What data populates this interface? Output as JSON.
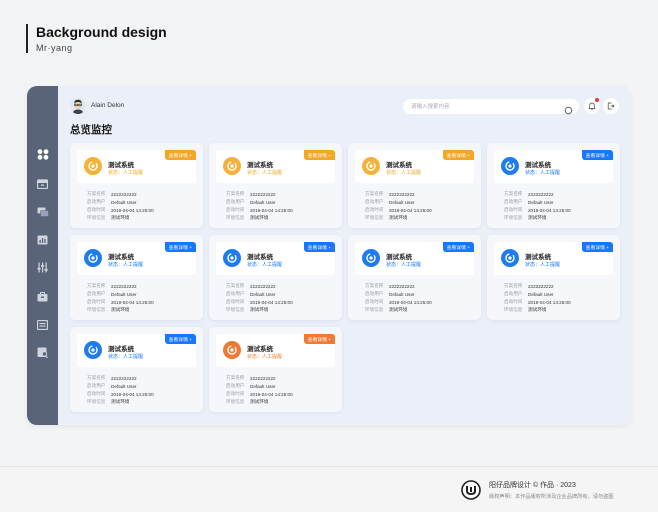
{
  "page": {
    "title": "Background design",
    "subtitle": "Mr·yang"
  },
  "sidebar": {
    "icons": [
      "dashboard-icon",
      "box-icon",
      "chat-icon",
      "chart-icon",
      "sliders-icon",
      "archive-icon",
      "list-icon",
      "search-doc-icon"
    ]
  },
  "topbar": {
    "user_name": "Alain Delon",
    "search_placeholder": "请输入搜索内容"
  },
  "section_title": "总览监控",
  "row_labels": [
    "方案名称",
    "启动用户",
    "启动时间",
    "环境信息"
  ],
  "colors": {
    "orange": "#f5a623",
    "blue": "#1677ff",
    "deep_orange": "#f07a35"
  },
  "cards": [
    {
      "name": "测试系统",
      "status": "状态：人工提醒",
      "button": "查看详情 +",
      "tone": "orange",
      "values": [
        "2222222222",
        "Default User",
        "2019-04-04  14:25:00",
        "测试环境"
      ]
    },
    {
      "name": "测试系统",
      "status": "状态：人工提醒",
      "button": "查看详情 +",
      "tone": "orange",
      "values": [
        "2222222222",
        "Default User",
        "2019-04-04  14:25:00",
        "测试环境"
      ]
    },
    {
      "name": "测试系统",
      "status": "状态：人工提醒",
      "button": "查看详情 +",
      "tone": "orange",
      "values": [
        "2222222222",
        "Default User",
        "2019-04-04  14:25:00",
        "测试环境"
      ]
    },
    {
      "name": "测试系统",
      "status": "状态：人工提醒",
      "button": "查看详情 +",
      "tone": "blue",
      "values": [
        "2222222222",
        "Default User",
        "2019-04-04  14:25:00",
        "测试环境"
      ]
    },
    {
      "name": "测试系统",
      "status": "状态：人工提醒",
      "button": "查看详情 +",
      "tone": "blue",
      "values": [
        "2222222222",
        "Default User",
        "2019-04-04  14:25:00",
        "测试环境"
      ]
    },
    {
      "name": "测试系统",
      "status": "状态：人工提醒",
      "button": "查看详情 +",
      "tone": "blue",
      "values": [
        "2222222222",
        "Default User",
        "2019-04-04  14:25:00",
        "测试环境"
      ]
    },
    {
      "name": "测试系统",
      "status": "状态：人工提醒",
      "button": "查看详情 +",
      "tone": "blue",
      "values": [
        "2222222222",
        "Default User",
        "2019-04-04  14:25:00",
        "测试环境"
      ]
    },
    {
      "name": "测试系统",
      "status": "状态：人工提醒",
      "button": "查看详情 +",
      "tone": "blue",
      "values": [
        "2222222222",
        "Default User",
        "2019-04-04  14:25:00",
        "测试环境"
      ]
    },
    {
      "name": "测试系统",
      "status": "状态：人工提醒",
      "button": "查看详情 +",
      "tone": "blue",
      "values": [
        "2222222222",
        "Default User",
        "2019-04-04  14:25:00",
        "测试环境"
      ]
    },
    {
      "name": "测试系统",
      "status": "状态：人工提醒",
      "button": "查看详情 +",
      "tone": "deep_orange",
      "values": [
        "2222222222",
        "Default User",
        "2019-04-04  14:25:00",
        "测试环境"
      ]
    }
  ],
  "footer": {
    "line1": "阳仔品牌设计 © 作品 · 2023",
    "line2": "版权声明：本作品版权所涉及企业品牌所有，请勿盗图"
  }
}
